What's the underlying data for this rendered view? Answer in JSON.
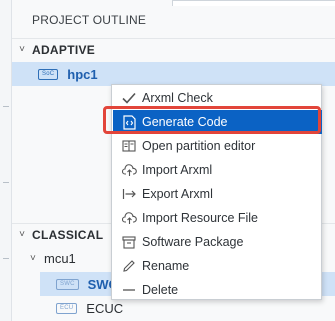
{
  "panel": {
    "title": "PROJECT OUTLINE"
  },
  "sections": {
    "adaptive": {
      "label": "ADAPTIVE",
      "chevron": "˅"
    },
    "classical": {
      "label": "CLASSICAL",
      "chevron": "˅"
    }
  },
  "tree": {
    "hpc1": {
      "badge": "SoC",
      "label": "hpc1"
    },
    "mcu1": {
      "chevron": "˅",
      "label": "mcu1"
    },
    "swc": {
      "badge": "SWC",
      "label": "SWC"
    },
    "ecuc": {
      "badge": "ECU",
      "label": "ECUC"
    }
  },
  "context_menu": {
    "items": [
      {
        "label": "Arxml Check",
        "icon": "check-icon"
      },
      {
        "label": "Generate Code",
        "icon": "code-file-icon",
        "active": true
      },
      {
        "label": "Open partition editor",
        "icon": "partition-icon"
      },
      {
        "label": "Import Arxml",
        "icon": "import-cloud-icon"
      },
      {
        "label": "Export Arxml",
        "icon": "export-arrow-icon"
      },
      {
        "label": "Import Resource File",
        "icon": "import-resource-icon"
      },
      {
        "label": "Software Package",
        "icon": "package-icon"
      },
      {
        "label": "Rename",
        "icon": "pencil-icon"
      },
      {
        "label": "Delete",
        "icon": "dash-icon"
      }
    ]
  },
  "colors": {
    "menu_active_bg": "#0b62c4",
    "highlight_ring": "#e2453a",
    "selected_row_bg": "#cfe2f7",
    "tree_item_blue": "#1f5fae"
  }
}
